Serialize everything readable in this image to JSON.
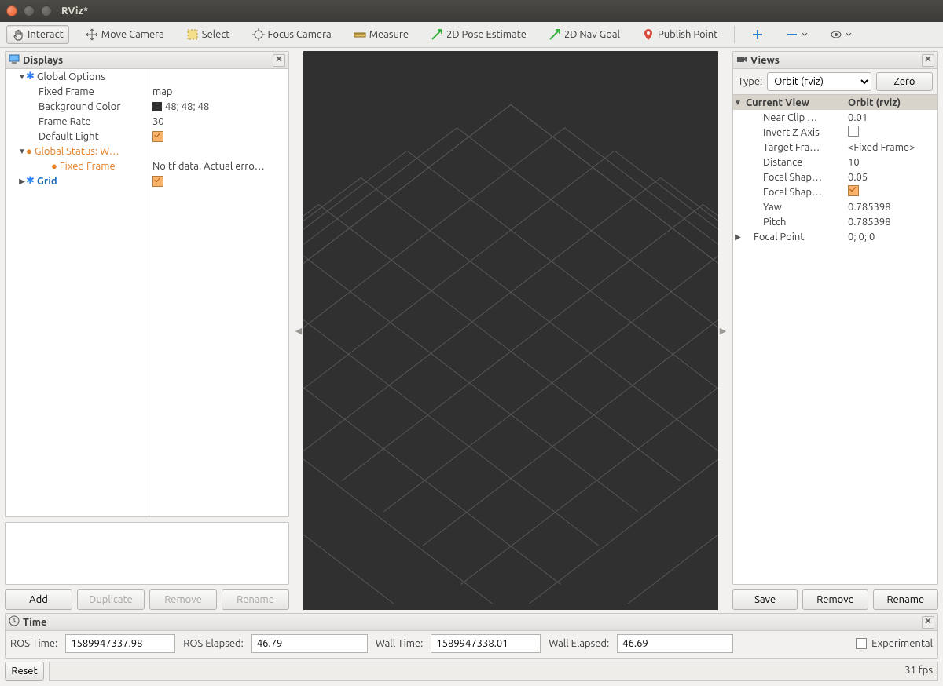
{
  "window": {
    "title": "RViz*"
  },
  "toolbar": {
    "interact": "Interact",
    "move_camera": "Move Camera",
    "select": "Select",
    "focus_camera": "Focus Camera",
    "measure": "Measure",
    "pose_estimate": "2D Pose Estimate",
    "nav_goal": "2D Nav Goal",
    "publish_point": "Publish Point"
  },
  "displays": {
    "title": "Displays",
    "global_options": {
      "label": "Global Options",
      "fixed_frame": {
        "k": "Fixed Frame",
        "v": "map"
      },
      "background": {
        "k": "Background Color",
        "v": "48; 48; 48"
      },
      "frame_rate": {
        "k": "Frame Rate",
        "v": "30"
      },
      "default_light": {
        "k": "Default Light"
      }
    },
    "global_status": {
      "label": "Global Status: W…",
      "fixed_frame": {
        "k": "Fixed Frame",
        "v": "No tf data.  Actual erro…"
      }
    },
    "grid": {
      "label": "Grid"
    },
    "buttons": {
      "add": "Add",
      "duplicate": "Duplicate",
      "remove": "Remove",
      "rename": "Rename"
    }
  },
  "views": {
    "title": "Views",
    "type_label": "Type:",
    "type_value": "Orbit (rviz)",
    "zero": "Zero",
    "current_view": {
      "k": "Current View",
      "v": "Orbit (rviz)"
    },
    "near_clip": {
      "k": "Near Clip …",
      "v": "0.01"
    },
    "invert_z": {
      "k": "Invert Z Axis"
    },
    "target_frame": {
      "k": "Target Fra…",
      "v": "<Fixed Frame>"
    },
    "distance": {
      "k": "Distance",
      "v": "10"
    },
    "focal_shape_size": {
      "k": "Focal Shap…",
      "v": "0.05"
    },
    "focal_shape_fixed": {
      "k": "Focal Shap…"
    },
    "yaw": {
      "k": "Yaw",
      "v": "0.785398"
    },
    "pitch": {
      "k": "Pitch",
      "v": "0.785398"
    },
    "focal_point": {
      "k": "Focal Point",
      "v": "0; 0; 0"
    },
    "buttons": {
      "save": "Save",
      "remove": "Remove",
      "rename": "Rename"
    }
  },
  "time": {
    "title": "Time",
    "ros_time": {
      "label": "ROS Time:",
      "value": "1589947337.98"
    },
    "ros_elapsed": {
      "label": "ROS Elapsed:",
      "value": "46.79"
    },
    "wall_time": {
      "label": "Wall Time:",
      "value": "1589947338.01"
    },
    "wall_elapsed": {
      "label": "Wall Elapsed:",
      "value": "46.69"
    },
    "experimental": "Experimental",
    "reset": "Reset",
    "fps": "31 fps"
  }
}
